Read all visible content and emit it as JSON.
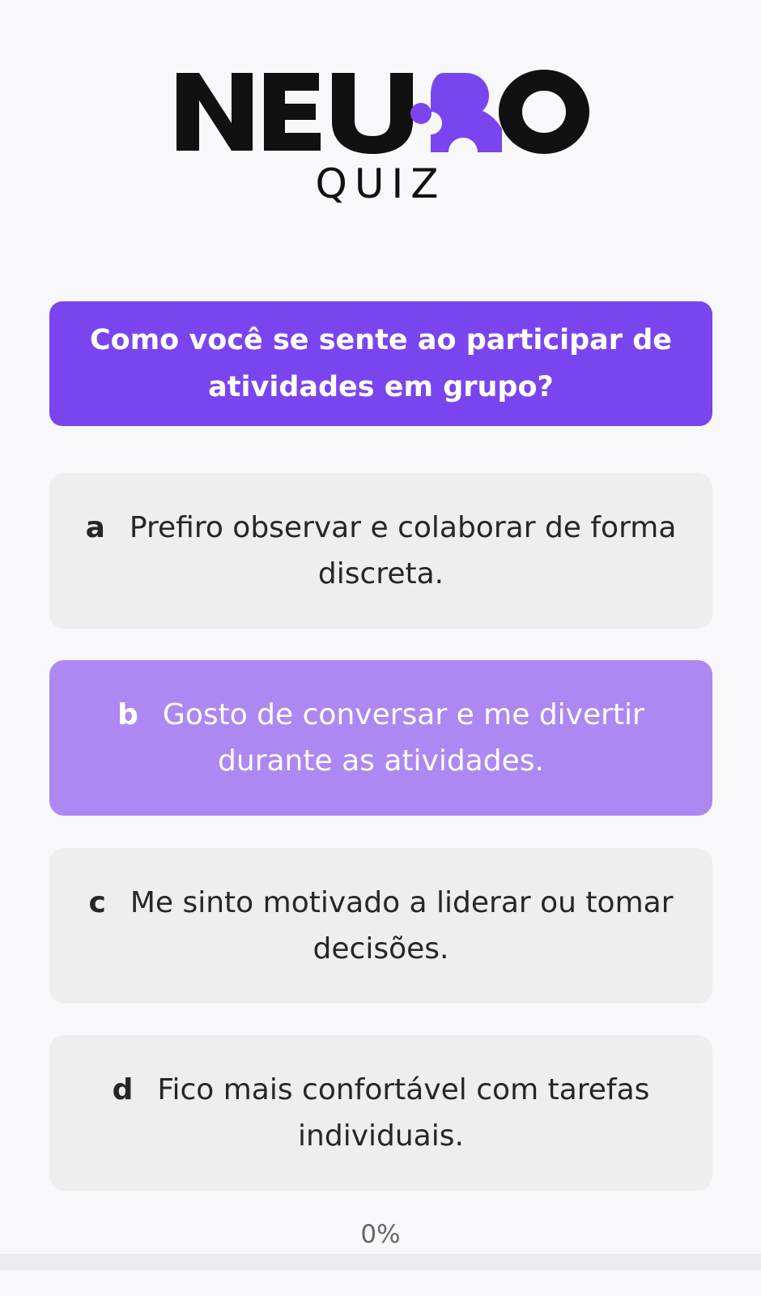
{
  "logo": {
    "wordmark_text": "NEURO",
    "subtitle": "QUIZ",
    "accent_color": "#7a45ef",
    "icon": "puzzle-piece-icon"
  },
  "question": {
    "text": "Como você se sente ao participar de atividades em grupo?"
  },
  "options": [
    {
      "letter": "a",
      "text": "Prefiro observar e colaborar de forma discreta.",
      "selected": false
    },
    {
      "letter": "b",
      "text": "Gosto de conversar e me divertir durante as atividades.",
      "selected": true
    },
    {
      "letter": "c",
      "text": "Me sinto motivado a liderar ou tomar decisões.",
      "selected": false
    },
    {
      "letter": "d",
      "text": "Fico mais confortável com tarefas individuais.",
      "selected": false
    }
  ],
  "progress": {
    "label": "0%",
    "value": 0
  },
  "colors": {
    "question_bg": "#7a45ef",
    "option_bg": "#eeeeee",
    "option_selected_bg": "#ad88f3",
    "page_bg": "#f8f8fa"
  }
}
